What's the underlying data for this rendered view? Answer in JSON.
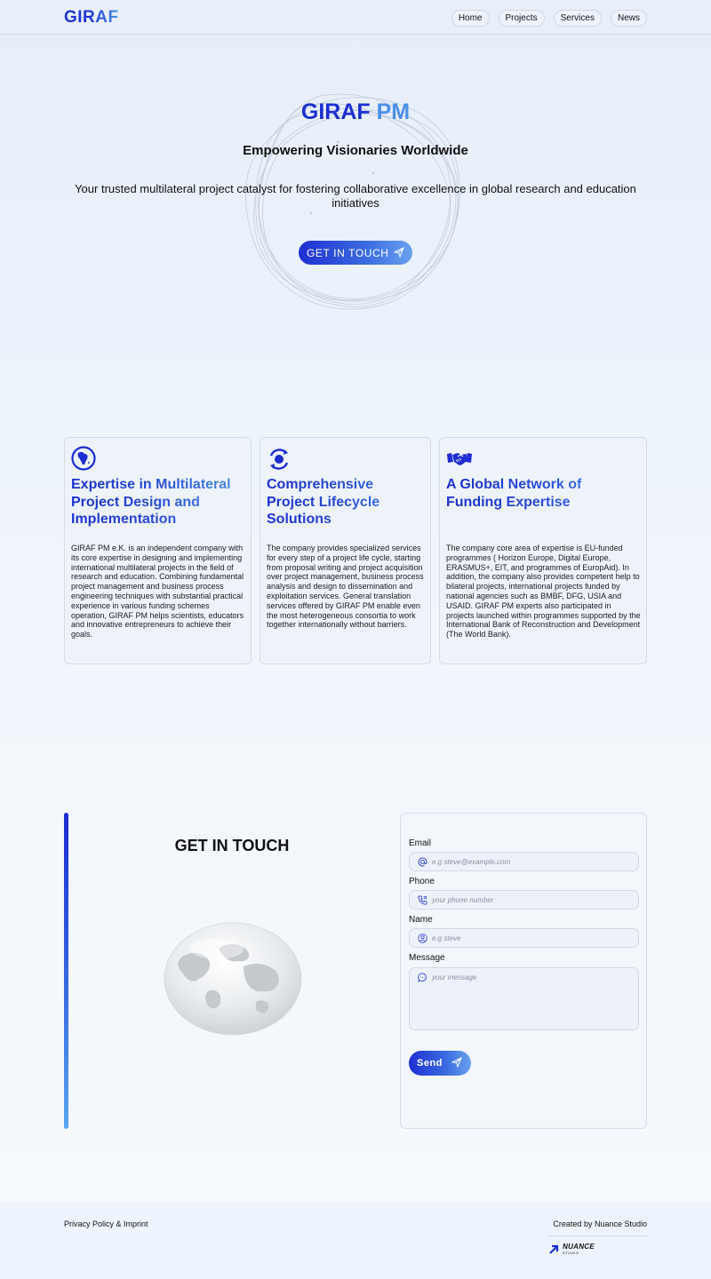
{
  "header": {
    "logo": "GIRAF",
    "nav": [
      {
        "label": "Home"
      },
      {
        "label": "Projects"
      },
      {
        "label": "Services"
      },
      {
        "label": "News"
      }
    ]
  },
  "hero": {
    "title_part1": "GIRAF",
    "title_part2": "PM",
    "subtitle": "Empowering Visionaries Worldwide",
    "description": "Your trusted multilateral project catalyst for fostering collaborative excellence in global research and education initiatives",
    "cta_label": "GET IN TOUCH",
    "cta_icon": "send-icon"
  },
  "cards": [
    {
      "icon": "globe-africa-icon",
      "title": "Expertise in Multilateral Project Design and Implementation",
      "body": "GIRAF PM e.K. is an independent company with its core expertise in designing and implementing international multilateral projects in the field of research and education. Combining fundamental project management and business process engineering techniques with substantial practical experience in various funding schemes operation, GIRAF PM helps scientists, educators and innovative entrepreneurs to achieve their goals."
    },
    {
      "icon": "lifecycle-icon",
      "title": "Comprehensive Project Lifecycle Solutions",
      "body": "The company provides specialized services for every step of a project life cycle, starting from proposal writing and project acquisition over project management, business process analysis and design to dissemination and exploitation services. General translation services offered by GIRAF PM enable even the most heterogeneous consortia to work together internationally without barriers."
    },
    {
      "icon": "handshake-icon",
      "title": "A Global Network of Funding Expertise",
      "body": "The company core area of expertise is EU-funded programmes ( Horizon Europe, Digital Europe, ERASMUS+, EIT, and programmes of EuropAid). In addition, the company also provides competent help to bilateral projects, international projects funded by national agencies such as BMBF, DFG, USIA and USAID. GIRAF PM experts also participated in projects launched within programmes supported by the International Bank of Reconstruction and Development (The World Bank)."
    }
  ],
  "contact": {
    "title": "GET IN TOUCH",
    "form": {
      "email_label": "Email",
      "email_placeholder": "e.g steve@example.com",
      "phone_label": "Phone",
      "phone_placeholder": "your phone number",
      "name_label": "Name",
      "name_placeholder": "e.g steve",
      "message_label": "Message",
      "message_placeholder": "your message",
      "send_label": "Send"
    }
  },
  "footer": {
    "left": "Privacy Policy & Imprint",
    "right": "Created by Nuance Studio",
    "brand_name": "NUANCE",
    "brand_sub": "STUDIO"
  },
  "colors": {
    "accent_dark": "#1f2fd2",
    "accent_light": "#5aa6ee",
    "background": "#edf3fb"
  }
}
